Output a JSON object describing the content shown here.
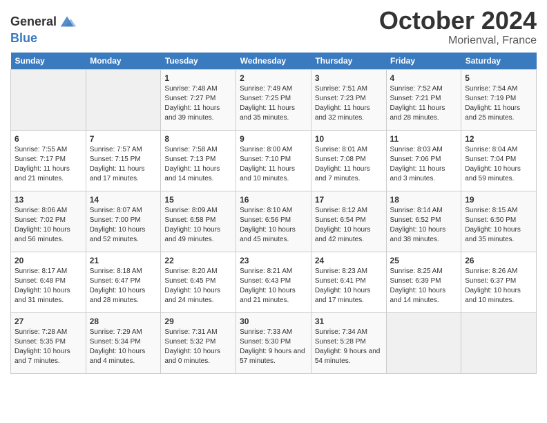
{
  "logo": {
    "line1": "General",
    "line2": "Blue"
  },
  "title": "October 2024",
  "subtitle": "Morienval, France",
  "days_of_week": [
    "Sunday",
    "Monday",
    "Tuesday",
    "Wednesday",
    "Thursday",
    "Friday",
    "Saturday"
  ],
  "weeks": [
    [
      {
        "day": "",
        "sunrise": "",
        "sunset": "",
        "daylight": ""
      },
      {
        "day": "",
        "sunrise": "",
        "sunset": "",
        "daylight": ""
      },
      {
        "day": "1",
        "sunrise": "Sunrise: 7:48 AM",
        "sunset": "Sunset: 7:27 PM",
        "daylight": "Daylight: 11 hours and 39 minutes."
      },
      {
        "day": "2",
        "sunrise": "Sunrise: 7:49 AM",
        "sunset": "Sunset: 7:25 PM",
        "daylight": "Daylight: 11 hours and 35 minutes."
      },
      {
        "day": "3",
        "sunrise": "Sunrise: 7:51 AM",
        "sunset": "Sunset: 7:23 PM",
        "daylight": "Daylight: 11 hours and 32 minutes."
      },
      {
        "day": "4",
        "sunrise": "Sunrise: 7:52 AM",
        "sunset": "Sunset: 7:21 PM",
        "daylight": "Daylight: 11 hours and 28 minutes."
      },
      {
        "day": "5",
        "sunrise": "Sunrise: 7:54 AM",
        "sunset": "Sunset: 7:19 PM",
        "daylight": "Daylight: 11 hours and 25 minutes."
      }
    ],
    [
      {
        "day": "6",
        "sunrise": "Sunrise: 7:55 AM",
        "sunset": "Sunset: 7:17 PM",
        "daylight": "Daylight: 11 hours and 21 minutes."
      },
      {
        "day": "7",
        "sunrise": "Sunrise: 7:57 AM",
        "sunset": "Sunset: 7:15 PM",
        "daylight": "Daylight: 11 hours and 17 minutes."
      },
      {
        "day": "8",
        "sunrise": "Sunrise: 7:58 AM",
        "sunset": "Sunset: 7:13 PM",
        "daylight": "Daylight: 11 hours and 14 minutes."
      },
      {
        "day": "9",
        "sunrise": "Sunrise: 8:00 AM",
        "sunset": "Sunset: 7:10 PM",
        "daylight": "Daylight: 11 hours and 10 minutes."
      },
      {
        "day": "10",
        "sunrise": "Sunrise: 8:01 AM",
        "sunset": "Sunset: 7:08 PM",
        "daylight": "Daylight: 11 hours and 7 minutes."
      },
      {
        "day": "11",
        "sunrise": "Sunrise: 8:03 AM",
        "sunset": "Sunset: 7:06 PM",
        "daylight": "Daylight: 11 hours and 3 minutes."
      },
      {
        "day": "12",
        "sunrise": "Sunrise: 8:04 AM",
        "sunset": "Sunset: 7:04 PM",
        "daylight": "Daylight: 10 hours and 59 minutes."
      }
    ],
    [
      {
        "day": "13",
        "sunrise": "Sunrise: 8:06 AM",
        "sunset": "Sunset: 7:02 PM",
        "daylight": "Daylight: 10 hours and 56 minutes."
      },
      {
        "day": "14",
        "sunrise": "Sunrise: 8:07 AM",
        "sunset": "Sunset: 7:00 PM",
        "daylight": "Daylight: 10 hours and 52 minutes."
      },
      {
        "day": "15",
        "sunrise": "Sunrise: 8:09 AM",
        "sunset": "Sunset: 6:58 PM",
        "daylight": "Daylight: 10 hours and 49 minutes."
      },
      {
        "day": "16",
        "sunrise": "Sunrise: 8:10 AM",
        "sunset": "Sunset: 6:56 PM",
        "daylight": "Daylight: 10 hours and 45 minutes."
      },
      {
        "day": "17",
        "sunrise": "Sunrise: 8:12 AM",
        "sunset": "Sunset: 6:54 PM",
        "daylight": "Daylight: 10 hours and 42 minutes."
      },
      {
        "day": "18",
        "sunrise": "Sunrise: 8:14 AM",
        "sunset": "Sunset: 6:52 PM",
        "daylight": "Daylight: 10 hours and 38 minutes."
      },
      {
        "day": "19",
        "sunrise": "Sunrise: 8:15 AM",
        "sunset": "Sunset: 6:50 PM",
        "daylight": "Daylight: 10 hours and 35 minutes."
      }
    ],
    [
      {
        "day": "20",
        "sunrise": "Sunrise: 8:17 AM",
        "sunset": "Sunset: 6:48 PM",
        "daylight": "Daylight: 10 hours and 31 minutes."
      },
      {
        "day": "21",
        "sunrise": "Sunrise: 8:18 AM",
        "sunset": "Sunset: 6:47 PM",
        "daylight": "Daylight: 10 hours and 28 minutes."
      },
      {
        "day": "22",
        "sunrise": "Sunrise: 8:20 AM",
        "sunset": "Sunset: 6:45 PM",
        "daylight": "Daylight: 10 hours and 24 minutes."
      },
      {
        "day": "23",
        "sunrise": "Sunrise: 8:21 AM",
        "sunset": "Sunset: 6:43 PM",
        "daylight": "Daylight: 10 hours and 21 minutes."
      },
      {
        "day": "24",
        "sunrise": "Sunrise: 8:23 AM",
        "sunset": "Sunset: 6:41 PM",
        "daylight": "Daylight: 10 hours and 17 minutes."
      },
      {
        "day": "25",
        "sunrise": "Sunrise: 8:25 AM",
        "sunset": "Sunset: 6:39 PM",
        "daylight": "Daylight: 10 hours and 14 minutes."
      },
      {
        "day": "26",
        "sunrise": "Sunrise: 8:26 AM",
        "sunset": "Sunset: 6:37 PM",
        "daylight": "Daylight: 10 hours and 10 minutes."
      }
    ],
    [
      {
        "day": "27",
        "sunrise": "Sunrise: 7:28 AM",
        "sunset": "Sunset: 5:35 PM",
        "daylight": "Daylight: 10 hours and 7 minutes."
      },
      {
        "day": "28",
        "sunrise": "Sunrise: 7:29 AM",
        "sunset": "Sunset: 5:34 PM",
        "daylight": "Daylight: 10 hours and 4 minutes."
      },
      {
        "day": "29",
        "sunrise": "Sunrise: 7:31 AM",
        "sunset": "Sunset: 5:32 PM",
        "daylight": "Daylight: 10 hours and 0 minutes."
      },
      {
        "day": "30",
        "sunrise": "Sunrise: 7:33 AM",
        "sunset": "Sunset: 5:30 PM",
        "daylight": "Daylight: 9 hours and 57 minutes."
      },
      {
        "day": "31",
        "sunrise": "Sunrise: 7:34 AM",
        "sunset": "Sunset: 5:28 PM",
        "daylight": "Daylight: 9 hours and 54 minutes."
      },
      {
        "day": "",
        "sunrise": "",
        "sunset": "",
        "daylight": ""
      },
      {
        "day": "",
        "sunrise": "",
        "sunset": "",
        "daylight": ""
      }
    ]
  ]
}
